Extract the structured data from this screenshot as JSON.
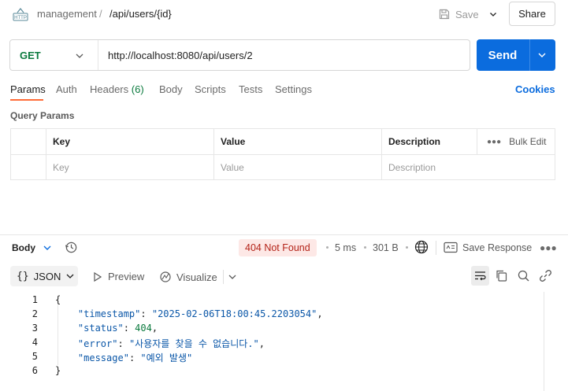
{
  "header": {
    "icon_text": "HTTP",
    "collection": "management",
    "separator": "/",
    "request_name": "/api/users/{id}",
    "save_label": "Save",
    "share_label": "Share"
  },
  "request": {
    "method": "GET",
    "url": "http://localhost:8080/api/users/2",
    "send_label": "Send"
  },
  "tabs": [
    {
      "label": "Params",
      "active": true
    },
    {
      "label": "Auth"
    },
    {
      "label": "Headers",
      "count": "(6)"
    },
    {
      "label": "Body"
    },
    {
      "label": "Scripts"
    },
    {
      "label": "Tests"
    },
    {
      "label": "Settings"
    }
  ],
  "cookies_label": "Cookies",
  "query_params": {
    "title": "Query Params",
    "headers": [
      "Key",
      "Value",
      "Description"
    ],
    "bulk_edit": "Bulk Edit",
    "placeholders": [
      "Key",
      "Value",
      "Description"
    ]
  },
  "response": {
    "body_label": "Body",
    "status": "404 Not Found",
    "time": "5 ms",
    "size": "301 B",
    "save_response": "Save Response",
    "format": "JSON",
    "preview": "Preview",
    "visualize": "Visualize",
    "lines": [
      {
        "n": "1",
        "text": "{"
      },
      {
        "n": "2",
        "key": "\"timestamp\"",
        "value": "\"2025-02-06T18:00:45.2203054\"",
        "kind": "str"
      },
      {
        "n": "3",
        "key": "\"status\"",
        "value": "404",
        "kind": "num"
      },
      {
        "n": "4",
        "key": "\"error\"",
        "value": "\"사용자를 찾을 수 없습니다.\"",
        "kind": "str"
      },
      {
        "n": "5",
        "key": "\"message\"",
        "value": "\"예외 발생\"",
        "kind": "str",
        "last": true
      },
      {
        "n": "6",
        "text": "}"
      }
    ]
  },
  "colors": {
    "accent": "#ff6c37",
    "primary": "#0b6cde",
    "get_method": "#0b7a3e",
    "error_bg": "#fde8e6",
    "error_text": "#b42318"
  }
}
